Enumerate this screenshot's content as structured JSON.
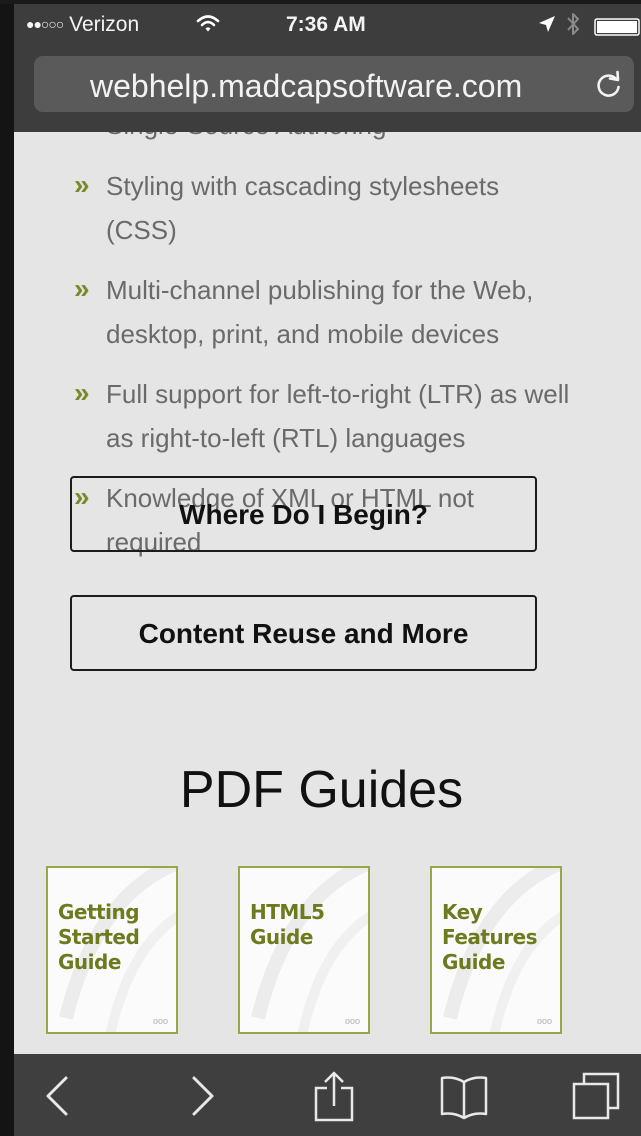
{
  "status_bar": {
    "signal": "●●○○○",
    "carrier": "Verizon",
    "time": "7:36 AM",
    "icons": [
      "wifi-icon",
      "location-arrow-icon",
      "bluetooth-icon",
      "battery-icon"
    ]
  },
  "browser": {
    "url": "webhelp.madcapsoftware.com",
    "reload_icon": "reload-icon"
  },
  "content": {
    "cut_off_line": "Single-Source Authoring",
    "bullet_marker": "»",
    "bullets": [
      "Styling with cascading stylesheets (CSS)",
      "Multi-channel publishing for the Web, desktop, print, and mobile devices",
      "Full support for left-to-right (LTR) as well as right-to-left (RTL) languages",
      "Knowledge of XML or HTML not required"
    ],
    "buttons": {
      "where_begin": "Where Do I Begin?",
      "content_reuse": "Content Reuse and More"
    },
    "pdf_heading": "PDF Guides",
    "guides": [
      {
        "label": "Getting Started Guide",
        "lines": [
          "Getting",
          "Started",
          "Guide"
        ]
      },
      {
        "label": "HTML5 Guide",
        "lines": [
          "HTML5",
          "Guide"
        ]
      },
      {
        "label": "Key Features Guide",
        "lines": [
          "Key",
          "Features",
          "Guide"
        ]
      }
    ],
    "guide_mark": "ooo"
  },
  "toolbar": {
    "icons": [
      "back-icon",
      "forward-icon",
      "share-icon",
      "bookmarks-icon",
      "tabs-icon"
    ]
  },
  "colors": {
    "accent": "#7a8a2a",
    "guide_text": "#6e7a1e",
    "chrome": "#3d3d3d",
    "page_bg": "#e5e5e5"
  }
}
